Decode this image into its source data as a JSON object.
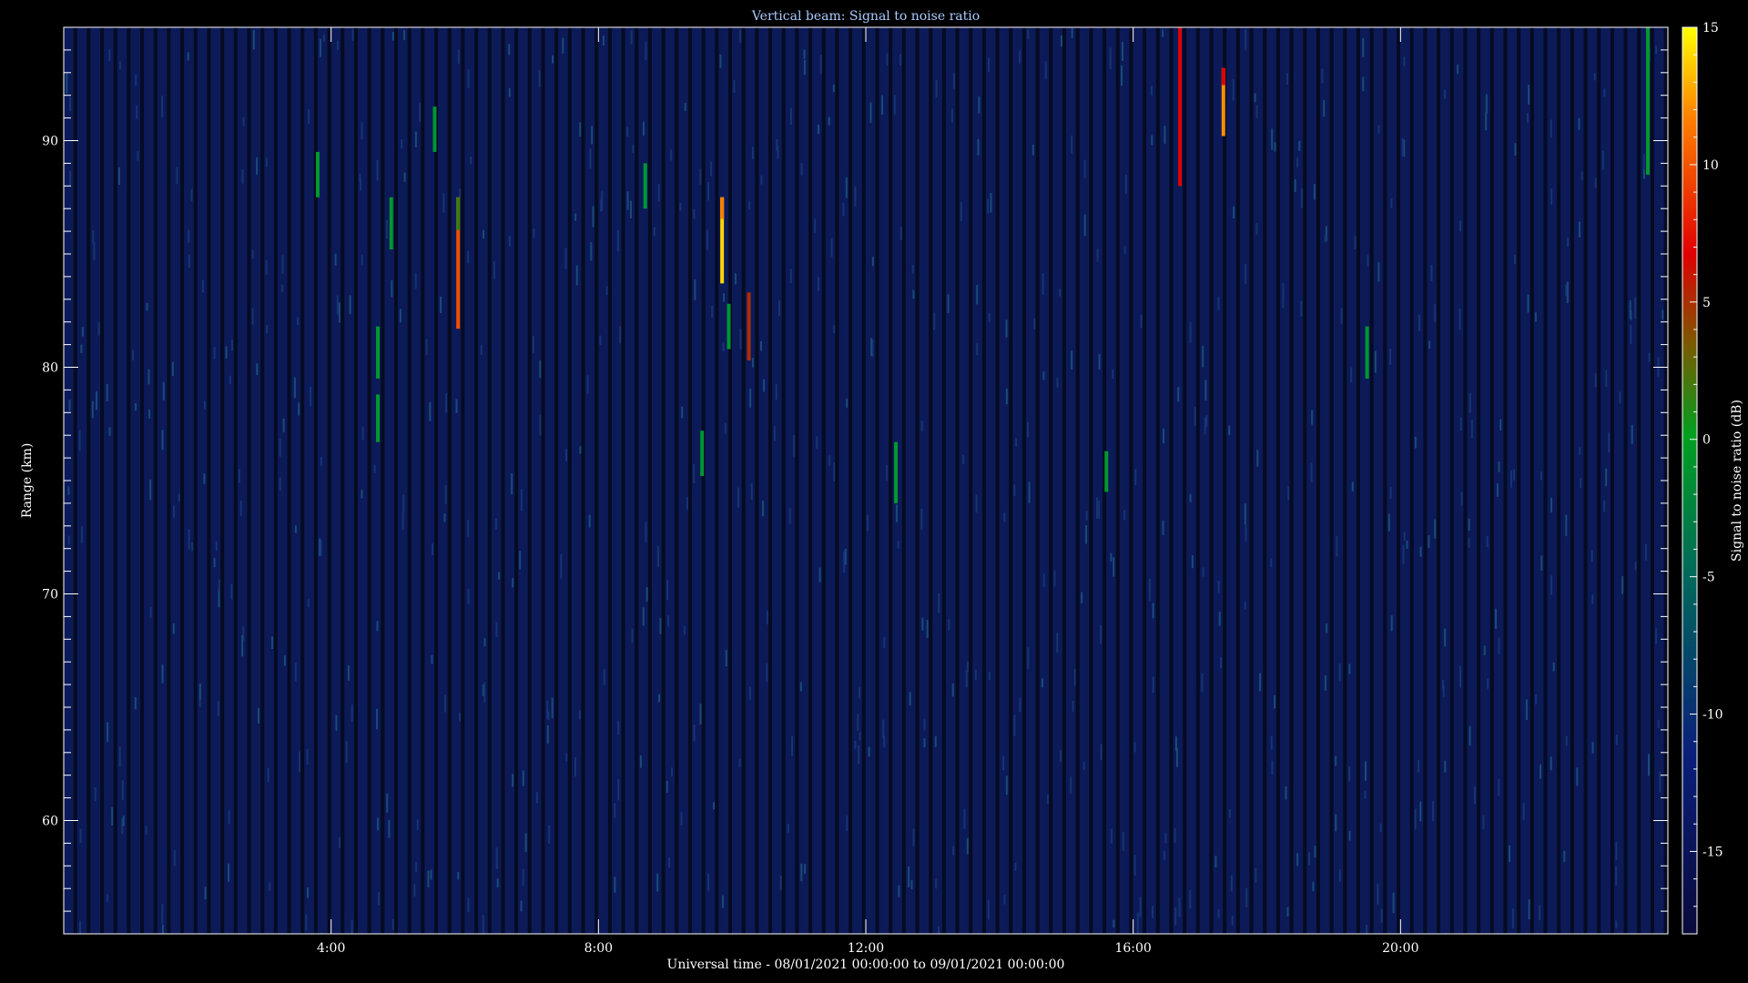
{
  "chart_data": {
    "type": "heatmap",
    "title": "Vertical beam: Signal to noise ratio",
    "xlabel": "Universal time - 08/01/2021 00:00:00 to 09/01/2021 00:00:00",
    "ylabel": "Range (km)",
    "colorbar_label": "Signal to noise ratio (dB)",
    "x_range_hours": [
      0,
      24
    ],
    "x_ticks": [
      {
        "value": 4,
        "label": "4:00"
      },
      {
        "value": 8,
        "label": "8:00"
      },
      {
        "value": 12,
        "label": "12:00"
      },
      {
        "value": 16,
        "label": "16:00"
      },
      {
        "value": 20,
        "label": "20:00"
      }
    ],
    "y_range_km": [
      55,
      95
    ],
    "y_ticks": [
      {
        "value": 60,
        "label": "60"
      },
      {
        "value": 70,
        "label": "70"
      },
      {
        "value": 80,
        "label": "80"
      },
      {
        "value": 90,
        "label": "90"
      }
    ],
    "color_range_db": [
      -18,
      15
    ],
    "colorbar_ticks": [
      {
        "value": 15,
        "label": "15"
      },
      {
        "value": 10,
        "label": "10"
      },
      {
        "value": 5,
        "label": "5"
      },
      {
        "value": 0,
        "label": "0"
      },
      {
        "value": -5,
        "label": "-5"
      },
      {
        "value": -10,
        "label": "-10"
      },
      {
        "value": -15,
        "label": "-15"
      }
    ],
    "background_level_db": -15,
    "echoes": [
      {
        "time_h": 3.8,
        "range_km": [
          87.5,
          89.5
        ],
        "snr_db": -5
      },
      {
        "time_h": 4.7,
        "range_km": [
          79.5,
          81.8
        ],
        "snr_db": -5
      },
      {
        "time_h": 4.7,
        "range_km": [
          76.7,
          78.8
        ],
        "snr_db": -5
      },
      {
        "time_h": 4.9,
        "range_km": [
          85.2,
          87.5
        ],
        "snr_db": -5
      },
      {
        "time_h": 5.55,
        "range_km": [
          89.5,
          91.5
        ],
        "snr_db": -6
      },
      {
        "time_h": 5.9,
        "range_km": [
          81.7,
          87.5
        ],
        "snr_db": 4
      },
      {
        "time_h": 8.7,
        "range_km": [
          87,
          89
        ],
        "snr_db": -6
      },
      {
        "time_h": 9.55,
        "range_km": [
          75.2,
          77.2
        ],
        "snr_db": -6
      },
      {
        "time_h": 9.85,
        "range_km": [
          83.7,
          87.5
        ],
        "snr_db": 12
      },
      {
        "time_h": 9.95,
        "range_km": [
          80.8,
          82.8
        ],
        "snr_db": -6
      },
      {
        "time_h": 10.25,
        "range_km": [
          80.3,
          83.3
        ],
        "snr_db": 0
      },
      {
        "time_h": 12.45,
        "range_km": [
          74,
          76.7
        ],
        "snr_db": -5
      },
      {
        "time_h": 15.6,
        "range_km": [
          74.5,
          76.3
        ],
        "snr_db": -5
      },
      {
        "time_h": 16.7,
        "range_km": [
          88,
          95
        ],
        "snr_db": 1
      },
      {
        "time_h": 17.35,
        "range_km": [
          90.2,
          93.2
        ],
        "snr_db": 7
      },
      {
        "time_h": 19.5,
        "range_km": [
          79.5,
          81.8
        ],
        "snr_db": -6
      },
      {
        "time_h": 23.7,
        "range_km": [
          88.5,
          95
        ],
        "snr_db": -5
      }
    ]
  }
}
